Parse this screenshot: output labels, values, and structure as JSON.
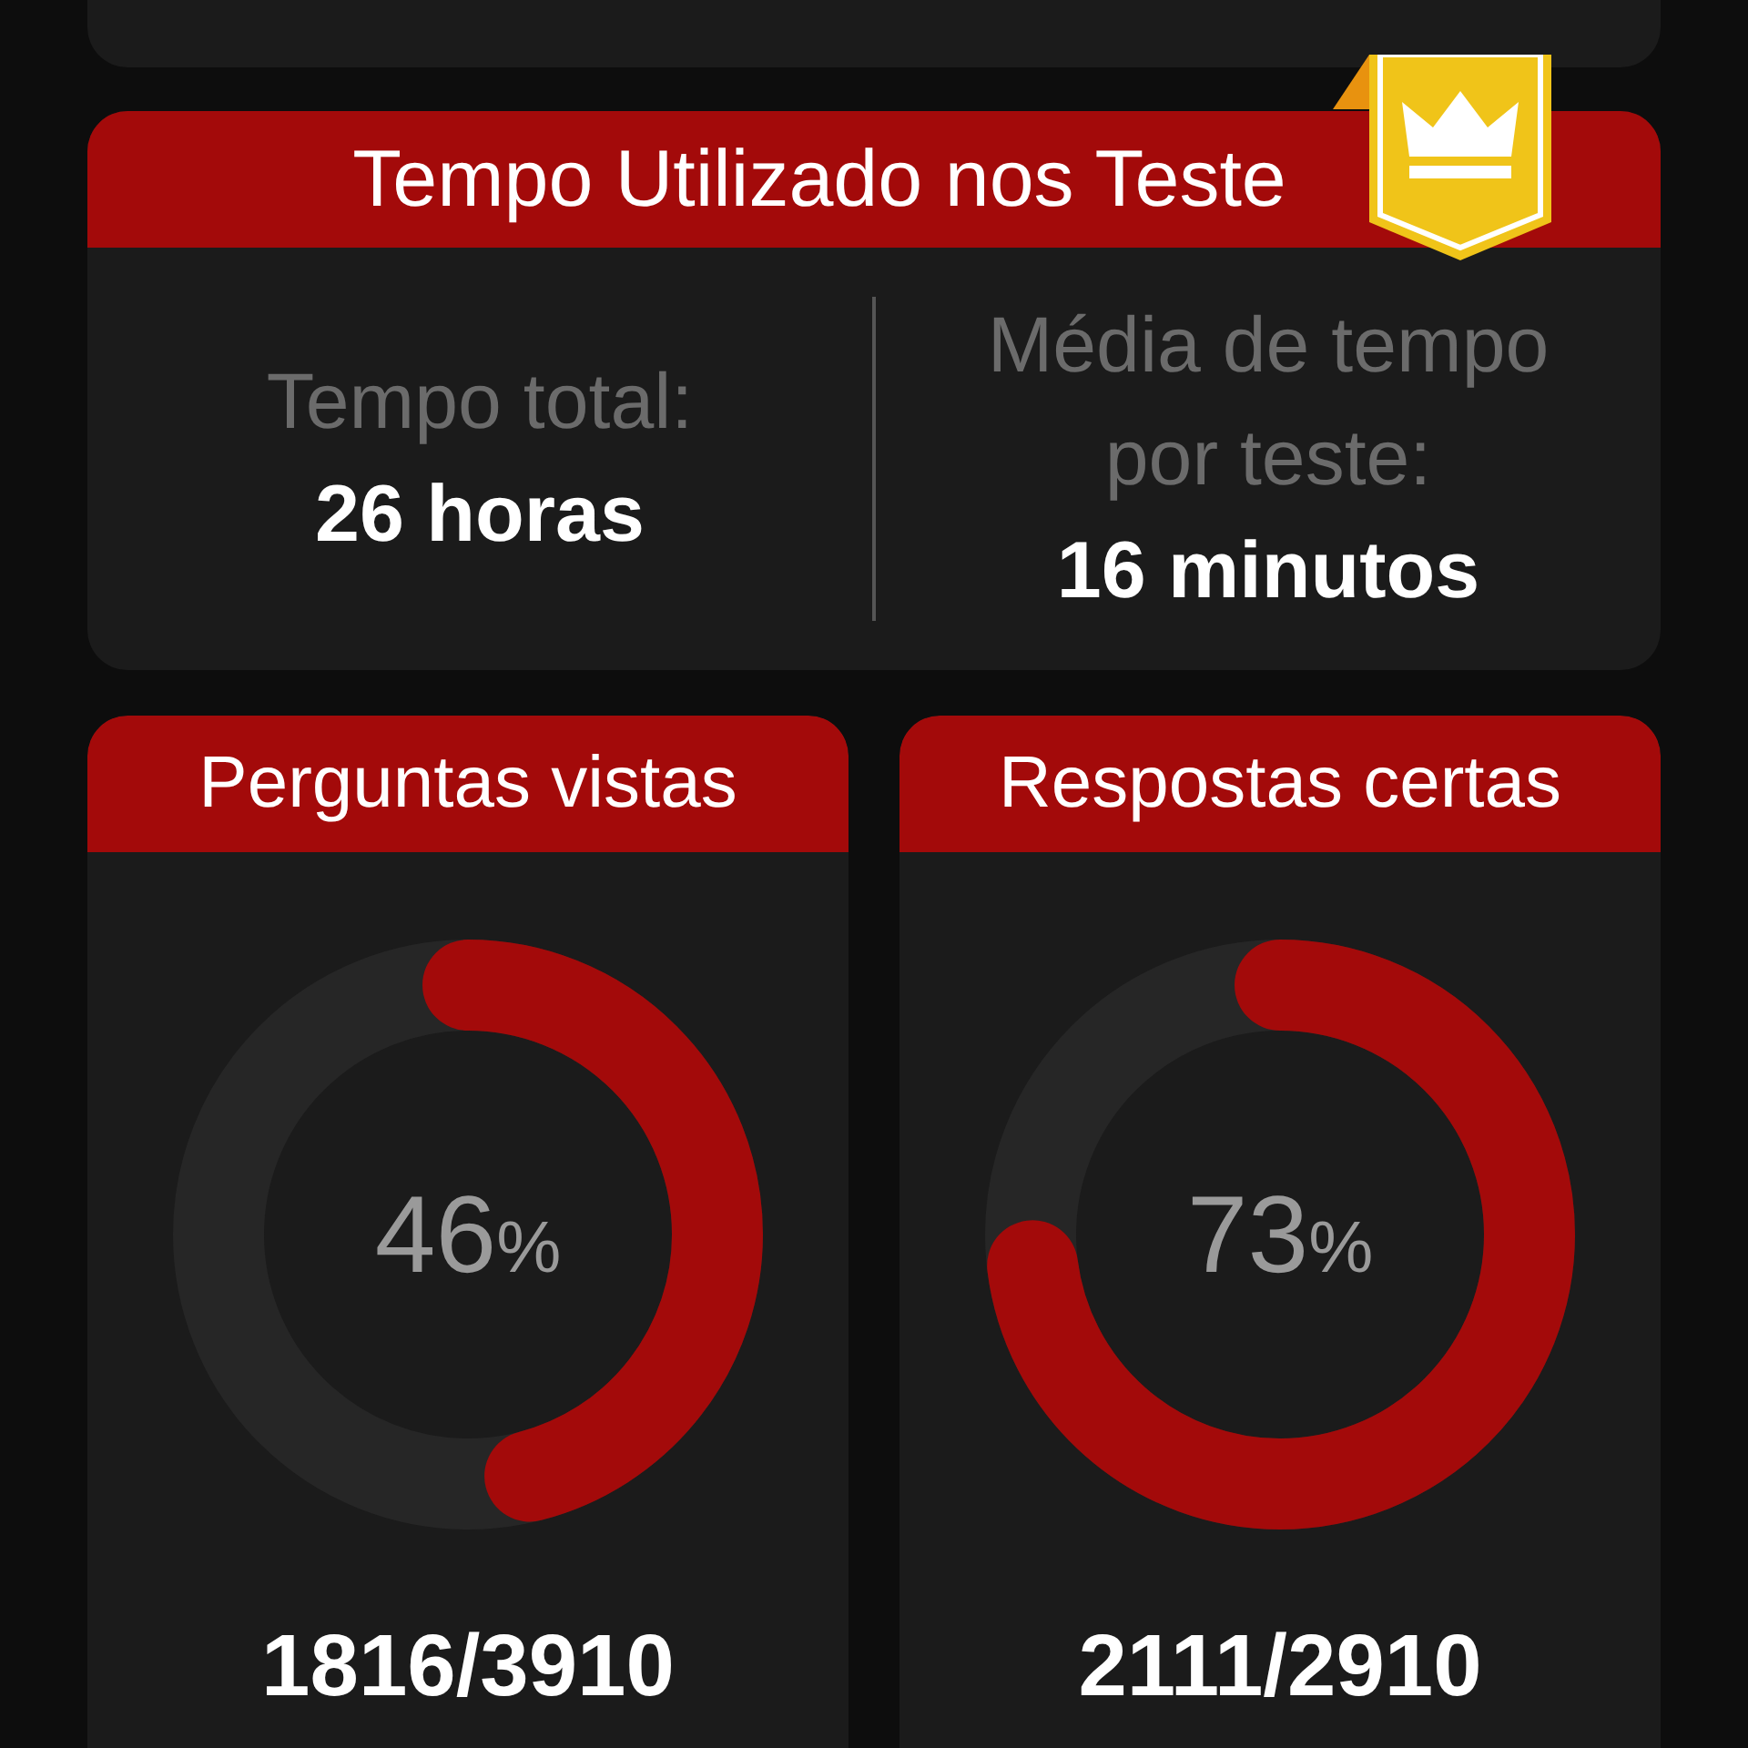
{
  "time_card": {
    "title": "Tempo Utilizado nos Teste",
    "total_label": "Tempo total:",
    "total_value": "26 horas",
    "average_label": "Média de tempo por teste:",
    "average_value": "16 minutos",
    "premium": true
  },
  "stat_cards": [
    {
      "title": "Perguntas vistas",
      "reading": "46",
      "unit": "%",
      "count": "1816/3910"
    },
    {
      "title": "Respostas certas",
      "reading": "73",
      "unit": "%",
      "count": "2111/2910"
    }
  ]
}
